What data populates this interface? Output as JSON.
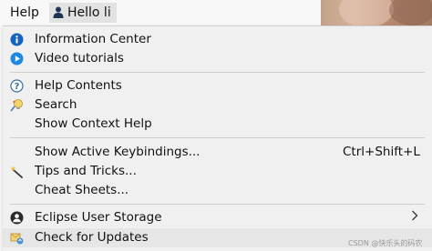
{
  "menubar": {
    "help_label": "Help",
    "user_label": "Hello li"
  },
  "menu": {
    "information_center": "Information Center",
    "video_tutorials": "Video tutorials",
    "help_contents": "Help Contents",
    "search": "Search",
    "show_context_help": "Show Context Help",
    "show_active_keybindings": "Show Active Keybindings...",
    "show_active_keybindings_accel": "Ctrl+Shift+L",
    "tips_and_tricks": "Tips and Tricks...",
    "cheat_sheets": "Cheat Sheets...",
    "eclipse_user_storage": "Eclipse User Storage",
    "check_for_updates": "Check for Updates"
  },
  "icons": {
    "information_center": "info-icon",
    "video_tutorials": "play-icon",
    "help_contents": "help-circle-icon",
    "search": "search-bulb-icon",
    "tips_and_tricks": "magic-wand-icon",
    "eclipse_user_storage": "user-storage-icon",
    "check_for_updates": "update-icon",
    "submenu": "chevron-right-icon"
  },
  "colors": {
    "info_blue": "#1565c0",
    "play_blue": "#1e88e5",
    "menu_bg": "#f0f0f0"
  },
  "watermark": "CSDN @快乐头的码农"
}
